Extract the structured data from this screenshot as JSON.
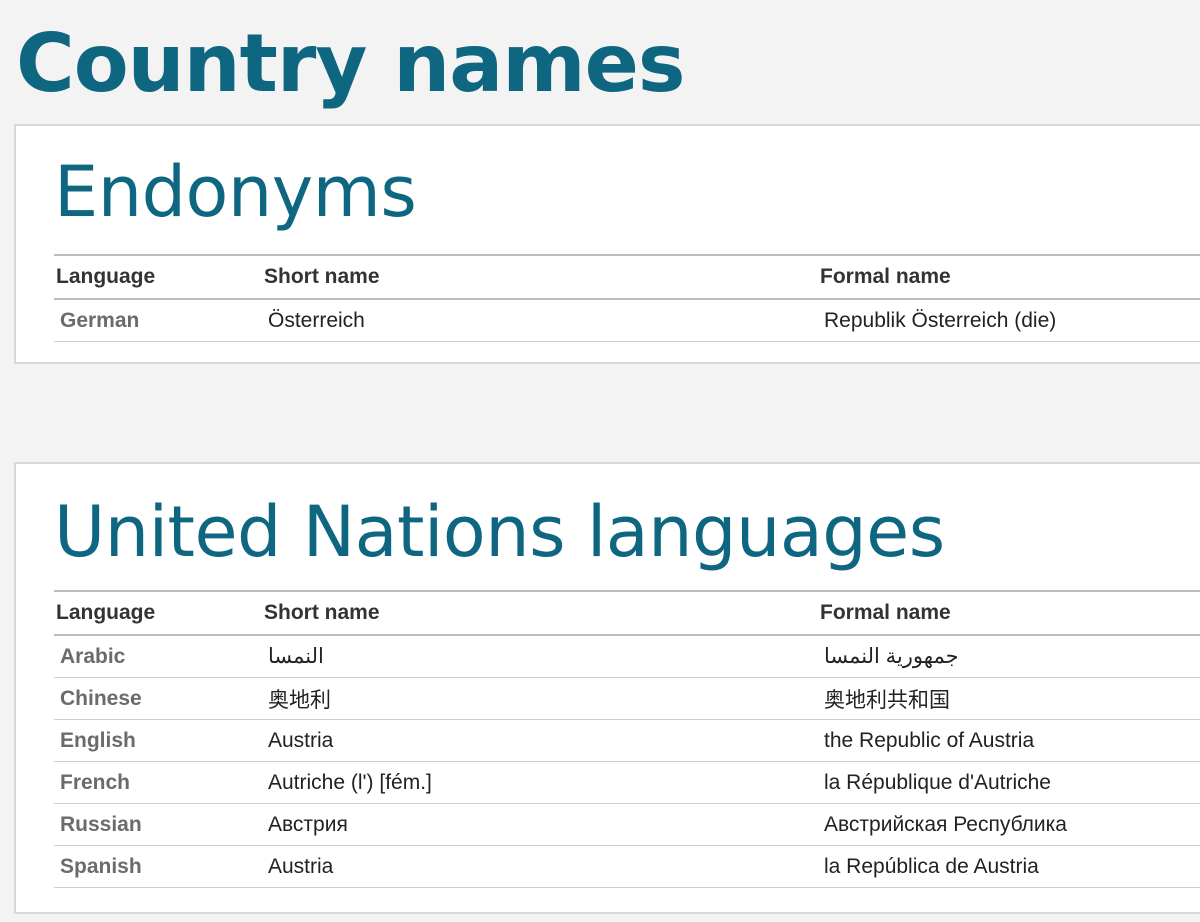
{
  "page": {
    "title": "Country names"
  },
  "endonyms": {
    "heading": "Endonyms",
    "columns": [
      "Language",
      "Short name",
      "Formal name"
    ],
    "rows": [
      {
        "language": "German",
        "short_name": "Österreich",
        "formal_name": "Republik Österreich (die)"
      }
    ]
  },
  "un_languages": {
    "heading": "United Nations languages",
    "columns": [
      "Language",
      "Short name",
      "Formal name"
    ],
    "rows": [
      {
        "language": "Arabic",
        "short_name": "النمسا",
        "formal_name": "جمهورية النمسا"
      },
      {
        "language": "Chinese",
        "short_name": "奥地利",
        "formal_name": "奥地利共和国"
      },
      {
        "language": "English",
        "short_name": "Austria",
        "formal_name": "the Republic of Austria"
      },
      {
        "language": "French",
        "short_name": "Autriche (l') [fém.]",
        "formal_name": "la République d'Autriche"
      },
      {
        "language": "Russian",
        "short_name": "Австрия",
        "formal_name": "Австрийская Республика"
      },
      {
        "language": "Spanish",
        "short_name": "Austria",
        "formal_name": "la República de Austria"
      }
    ]
  },
  "colors": {
    "heading": "#0f6680",
    "background": "#f3f3f3",
    "panel": "#ffffff",
    "language_label": "#6b6b6b"
  }
}
